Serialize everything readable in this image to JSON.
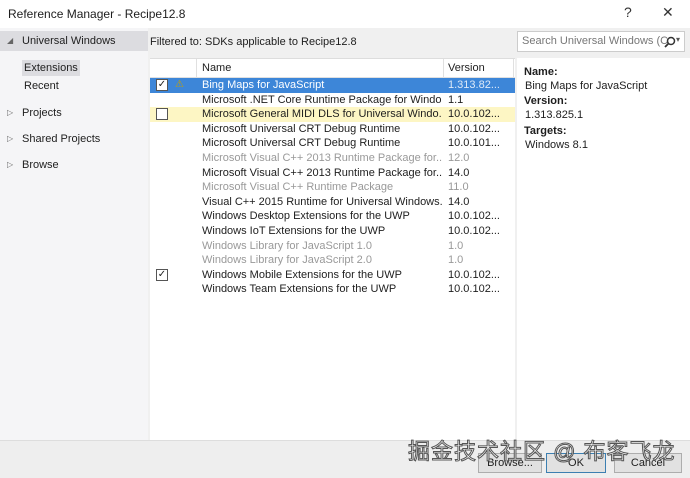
{
  "window": {
    "title": "Reference Manager - Recipe12.8",
    "help": "?",
    "close": "✕"
  },
  "sidebar": {
    "items": [
      {
        "label": "Universal Windows",
        "arrow": "◢",
        "expanded": true,
        "sub": [
          "Extensions",
          "Recent"
        ]
      },
      {
        "label": "Projects",
        "arrow": "▷"
      },
      {
        "label": "Shared Projects",
        "arrow": "▷"
      },
      {
        "label": "Browse",
        "arrow": "▷"
      }
    ]
  },
  "filter_text": "Filtered to: SDKs applicable to Recipe12.8",
  "search": {
    "placeholder": "Search Universal Windows (C",
    "icon": "search-icon"
  },
  "list": {
    "columns": [
      "Name",
      "Version"
    ],
    "rows": [
      {
        "name": "Bing Maps for JavaScript",
        "version": "1.313.82...",
        "checked": true,
        "warning": true,
        "state": "selected"
      },
      {
        "name": "Microsoft .NET Core Runtime Package for Windo...",
        "version": "1.1",
        "state": "normal"
      },
      {
        "name": "Microsoft General MIDI DLS for Universal Windo...",
        "version": "10.0.102...",
        "checked": false,
        "state": "hover"
      },
      {
        "name": "Microsoft Universal CRT Debug Runtime",
        "version": "10.0.102...",
        "state": "normal"
      },
      {
        "name": "Microsoft Universal CRT Debug Runtime",
        "version": "10.0.101...",
        "state": "normal"
      },
      {
        "name": "Microsoft Visual C++ 2013 Runtime Package for...",
        "version": "12.0",
        "state": "disabled"
      },
      {
        "name": "Microsoft Visual C++ 2013 Runtime Package for...",
        "version": "14.0",
        "state": "normal"
      },
      {
        "name": "Microsoft Visual C++ Runtime Package",
        "version": "11.0",
        "state": "disabled"
      },
      {
        "name": "Visual C++ 2015 Runtime for Universal Windows...",
        "version": "14.0",
        "state": "normal"
      },
      {
        "name": "Windows Desktop Extensions for the UWP",
        "version": "10.0.102...",
        "state": "normal"
      },
      {
        "name": "Windows IoT Extensions for the UWP",
        "version": "10.0.102...",
        "state": "normal"
      },
      {
        "name": "Windows Library for JavaScript 1.0",
        "version": "1.0",
        "state": "disabled"
      },
      {
        "name": "Windows Library for JavaScript 2.0",
        "version": "1.0",
        "state": "disabled"
      },
      {
        "name": "Windows Mobile Extensions for the UWP",
        "version": "10.0.102...",
        "checked": true,
        "state": "normal"
      },
      {
        "name": "Windows Team Extensions for the UWP",
        "version": "10.0.102...",
        "state": "normal"
      }
    ]
  },
  "details": {
    "name_label": "Name:",
    "name": "Bing Maps for JavaScript",
    "version_label": "Version:",
    "version": "1.313.825.1",
    "targets_label": "Targets:",
    "targets": "Windows 8.1"
  },
  "buttons": {
    "browse": "Browse...",
    "ok": "OK",
    "cancel": "Cancel"
  },
  "watermark": "掘金技术社区 @ 布客飞龙"
}
